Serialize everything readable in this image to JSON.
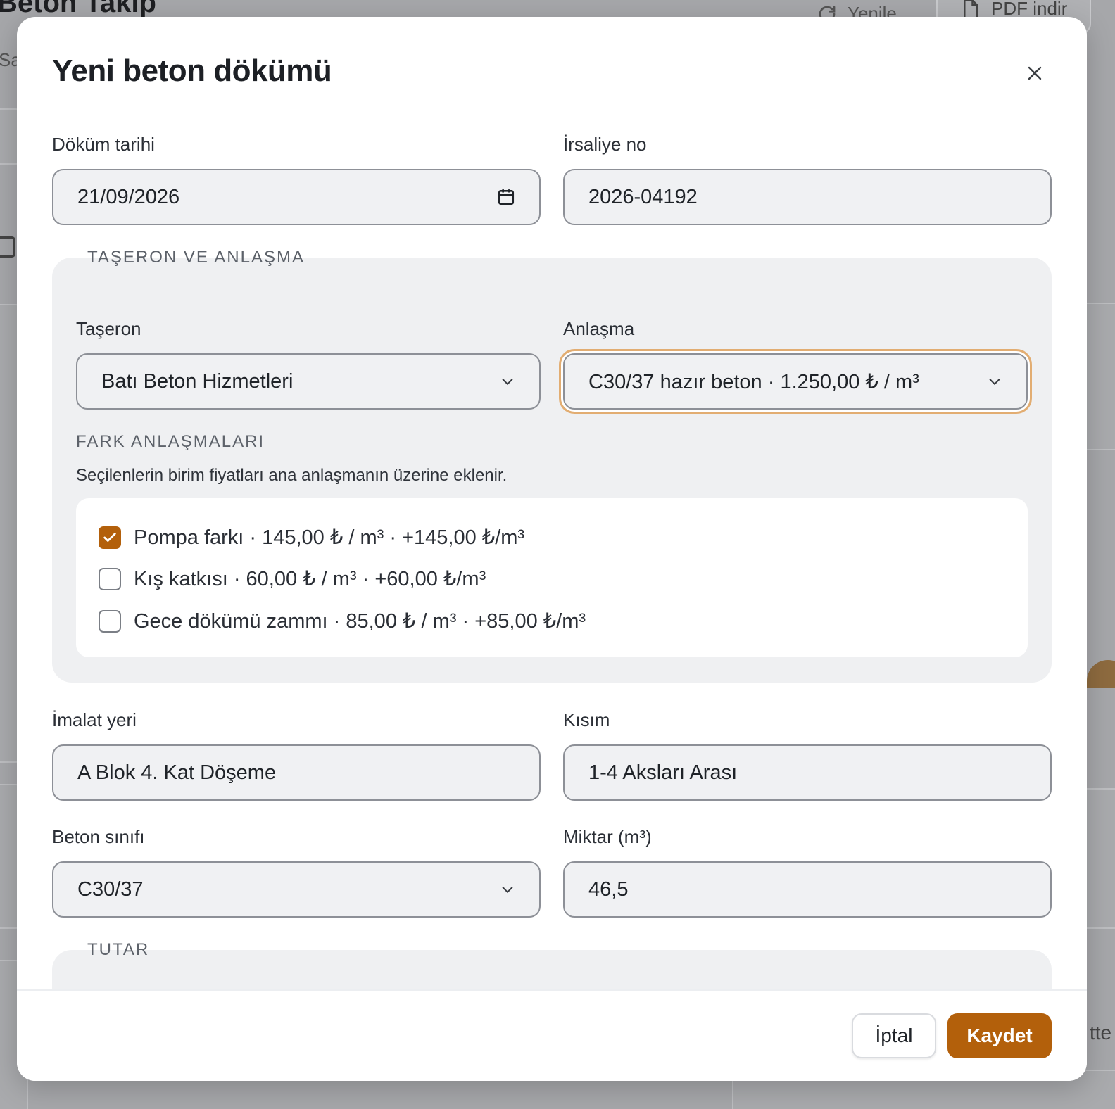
{
  "background": {
    "title": "Beton Takip",
    "subtitle": "Sa",
    "refresh_label": "Yenile",
    "pdf_label": "PDF indir",
    "right_fragment": "tte"
  },
  "modal": {
    "title": "Yeni beton dökümü",
    "fields": {
      "dokum_tarihi": {
        "label": "Döküm tarihi",
        "value": "21/09/2026"
      },
      "irsaliye_no": {
        "label": "İrsaliye no",
        "value": "2026-04192"
      },
      "imalat_yeri": {
        "label": "İmalat yeri",
        "value": "A Blok 4. Kat Döşeme"
      },
      "kisim": {
        "label": "Kısım",
        "value": "1-4 Aksları Arası"
      },
      "beton_sinifi": {
        "label": "Beton sınıfı",
        "value": "C30/37"
      },
      "miktar": {
        "label": "Miktar (m³)",
        "value": "46,5"
      }
    },
    "taseron_section": {
      "legend": "TAŞERON VE ANLAŞMA",
      "taseron": {
        "label": "Taşeron",
        "value": "Batı Beton Hizmetleri"
      },
      "anlasma": {
        "label": "Anlaşma",
        "value": "C30/37 hazır beton · 1.250,00 ₺ / m³"
      },
      "fark_heading": "FARK ANLAŞMALARI",
      "fark_hint": "Seçilenlerin birim fiyatları ana anlaşmanın üzerine eklenir.",
      "options": [
        {
          "label": "Pompa farkı · 145,00 ₺ / m³ · +145,00 ₺/m³",
          "checked": true
        },
        {
          "label": "Kış katkısı · 60,00 ₺ / m³ · +60,00 ₺/m³",
          "checked": false
        },
        {
          "label": "Gece dökümü zammı · 85,00 ₺ / m³ · +85,00 ₺/m³",
          "checked": false
        }
      ]
    },
    "tutar_section": {
      "legend": "TUTAR"
    },
    "footer": {
      "cancel_label": "İptal",
      "save_label": "Kaydet"
    }
  },
  "colors": {
    "accent": "#b3600b",
    "focus_ring": "#e2ad72",
    "field_bg": "#f0f1f3",
    "section_bg": "#eff0f2"
  },
  "icons": [
    "close-icon",
    "calendar-icon",
    "chevron-down-icon",
    "checkmark-icon",
    "refresh-icon",
    "file-icon"
  ]
}
